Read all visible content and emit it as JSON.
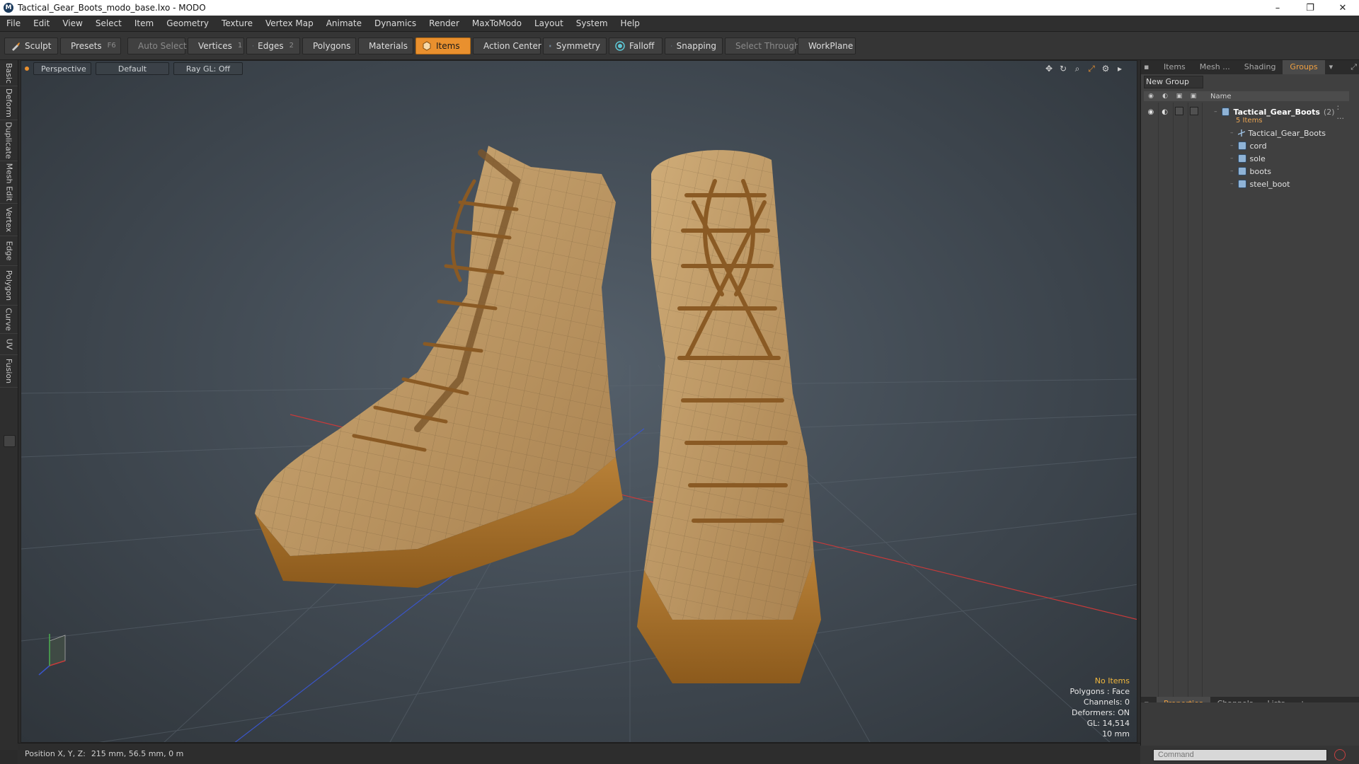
{
  "window": {
    "title": "Tactical_Gear_Boots_modo_base.lxo - MODO",
    "minimize": "–",
    "restore": "❐",
    "close": "✕"
  },
  "menu": [
    "File",
    "Edit",
    "View",
    "Select",
    "Item",
    "Geometry",
    "Texture",
    "Vertex Map",
    "Animate",
    "Dynamics",
    "Render",
    "MaxToModo",
    "Layout",
    "System",
    "Help"
  ],
  "toolbar": {
    "sculpt": "Sculpt",
    "presets": "Presets",
    "presets_key": "F6",
    "auto_select": "Auto Select",
    "vertices": "Vertices",
    "vertices_key": "1",
    "edges": "Edges",
    "edges_key": "2",
    "polygons": "Polygons",
    "materials": "Materials",
    "items": "Items",
    "action_center": "Action Center",
    "symmetry": "Symmetry",
    "falloff": "Falloff",
    "snapping": "Snapping",
    "select_through": "Select Through",
    "workplane": "WorkPlane"
  },
  "left_tabs": [
    "Basic",
    "Deform",
    "Duplicate",
    "Mesh Edit",
    "Vertex",
    "Edge",
    "Polygon",
    "Curve",
    "UV",
    "Fusion"
  ],
  "viewport": {
    "view": "Perspective",
    "shading": "Default",
    "raygl": "Ray GL: Off",
    "info": {
      "selection": "No Items",
      "polygons": "Polygons : Face",
      "channels": "Channels: 0",
      "deformers": "Deformers: ON",
      "gl": "GL: 14,514",
      "scale": "10 mm"
    }
  },
  "right_panel": {
    "tabs": [
      "Items",
      "Mesh ...",
      "Shading",
      "Groups"
    ],
    "active_tab": "Groups",
    "new_group": "New Group",
    "name_header": "Name",
    "group": {
      "name": "Tactical_Gear_Boots",
      "count": "(2)",
      "more": ": ...",
      "sub": "5 Items"
    },
    "children": [
      "Tactical_Gear_Boots",
      "cord",
      "sole",
      "boots",
      "steel_boot"
    ],
    "bottom_tabs": [
      "Properties",
      "Channels",
      "Lists",
      "+"
    ],
    "command_placeholder": "Command"
  },
  "status": {
    "label": "Position X, Y, Z:",
    "value": "215 mm, 56.5 mm, 0 m"
  },
  "colors": {
    "accent": "#e9902e",
    "boot_leather": "#b8925f",
    "boot_sole": "#a8742e",
    "axis_x": "#c83a3a",
    "axis_z": "#3a55c8"
  }
}
